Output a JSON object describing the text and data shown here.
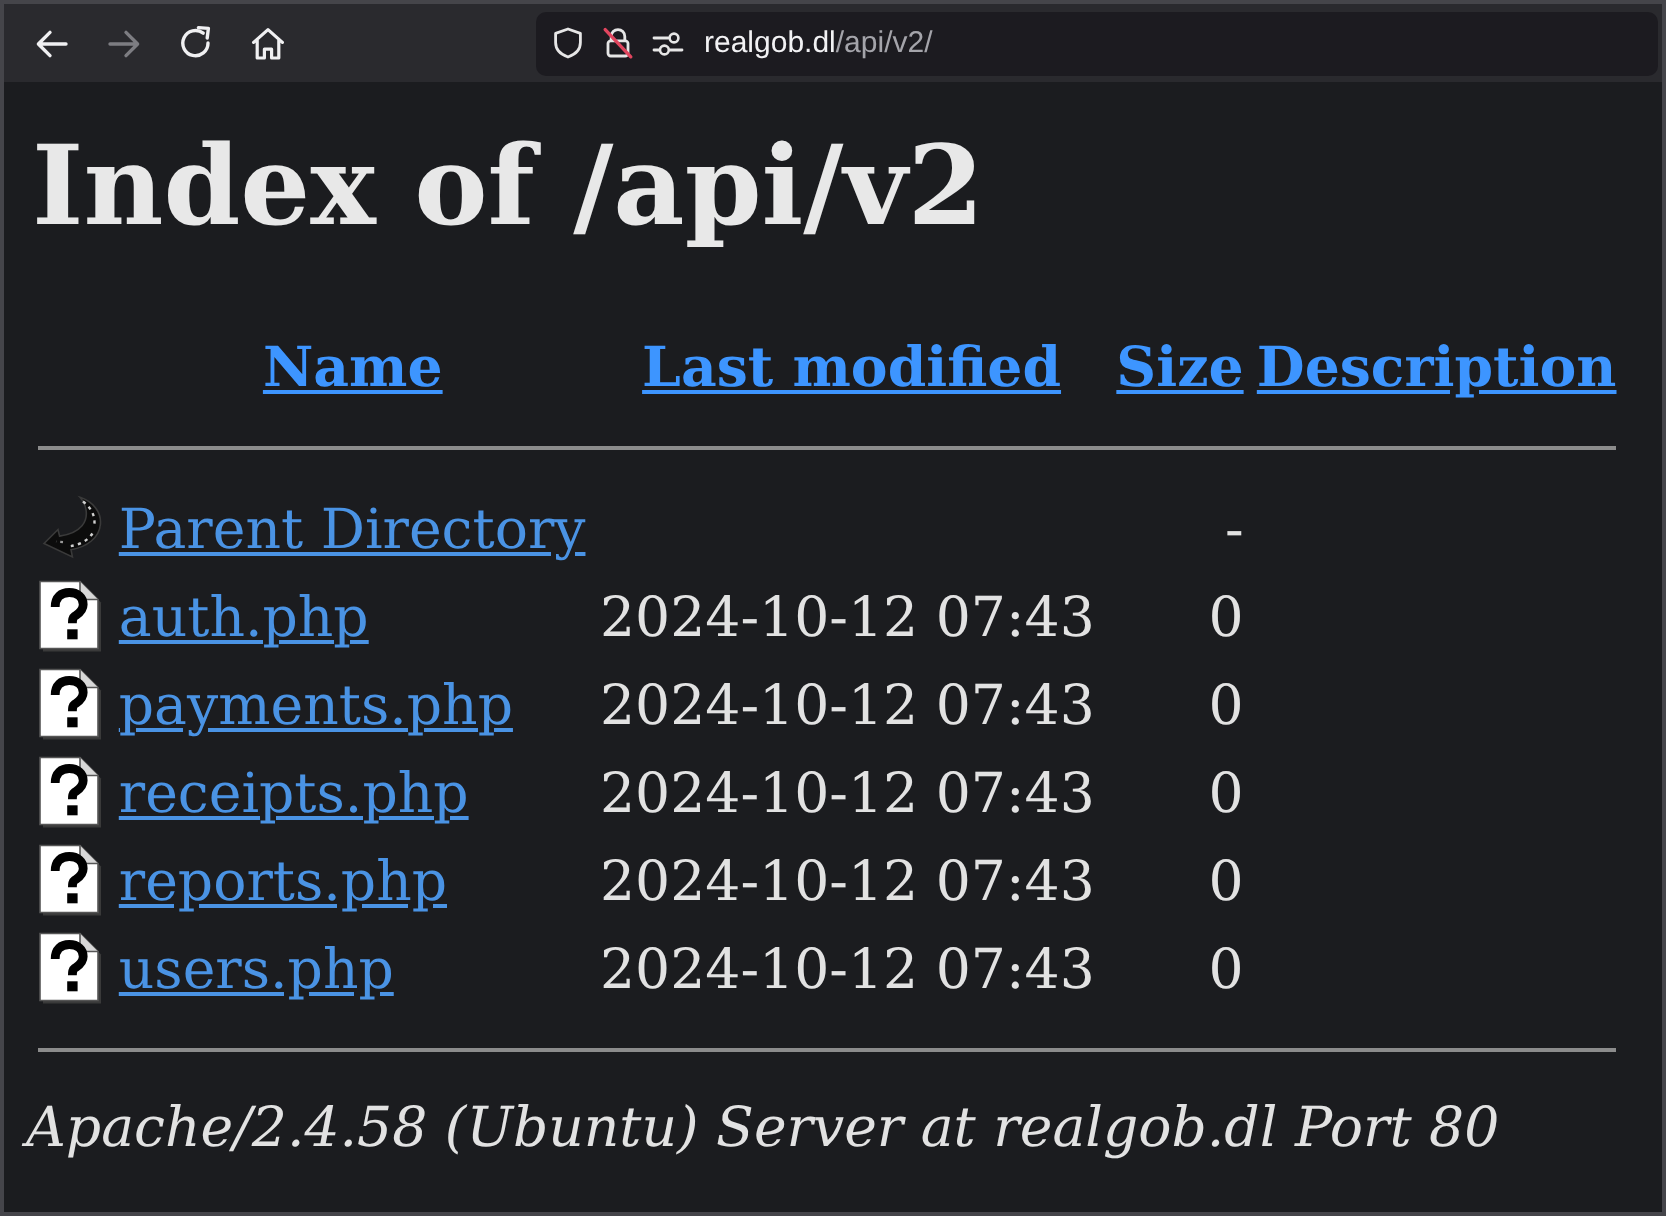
{
  "browser": {
    "nav_buttons": [
      {
        "kind": "back",
        "disabled": false
      },
      {
        "kind": "forward",
        "disabled": true
      },
      {
        "kind": "reload",
        "disabled": false
      },
      {
        "kind": "home",
        "disabled": false
      }
    ],
    "url": {
      "host": "realgob.dl",
      "path": "/api/v2/"
    }
  },
  "page": {
    "title": "Index of /api/v2",
    "columns": [
      {
        "label": "Name"
      },
      {
        "label": "Last modified"
      },
      {
        "label": "Size"
      },
      {
        "label": "Description"
      }
    ],
    "rows": [
      {
        "kind": "parent",
        "name": "Parent Directory",
        "size": "-"
      },
      {
        "kind": "file",
        "name": "auth.php",
        "modified": "2024-10-12 07:43",
        "size": "0"
      },
      {
        "kind": "file",
        "name": "payments.php",
        "modified": "2024-10-12 07:43",
        "size": "0"
      },
      {
        "kind": "file",
        "name": "receipts.php",
        "modified": "2024-10-12 07:43",
        "size": "0"
      },
      {
        "kind": "file",
        "name": "reports.php",
        "modified": "2024-10-12 07:43",
        "size": "0"
      },
      {
        "kind": "file",
        "name": "users.php",
        "modified": "2024-10-12 07:43",
        "size": "0"
      }
    ],
    "footer": "Apache/2.4.58 (Ubuntu) Server at realgob.dl Port 80"
  }
}
